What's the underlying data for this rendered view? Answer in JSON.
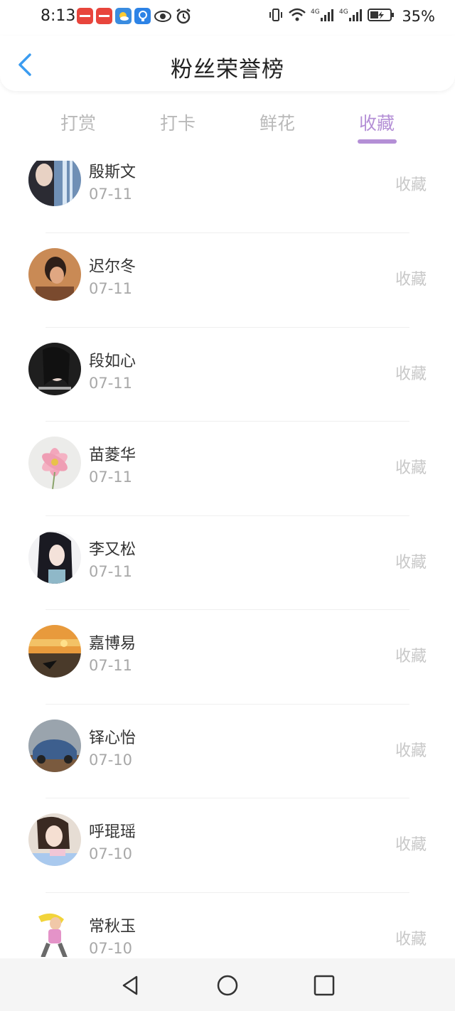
{
  "status_bar": {
    "time": "8:13",
    "battery": "35%",
    "icons": [
      "huawei-app-icon",
      "huawei-app-icon",
      "weather-icon",
      "bulb-icon",
      "eye-icon",
      "alarm-icon",
      "vibrate-icon",
      "wifi-icon",
      "signal-4g-icon",
      "signal-4g-icon",
      "battery-icon"
    ]
  },
  "header": {
    "title": "粉丝荣誉榜",
    "back_icon": "chevron-left-icon"
  },
  "tabs": [
    {
      "label": "打赏",
      "active": false
    },
    {
      "label": "打卡",
      "active": false
    },
    {
      "label": "鲜花",
      "active": false
    },
    {
      "label": "收藏",
      "active": true
    }
  ],
  "accent_color": "#b48fd6",
  "rows": [
    {
      "name": "殷斯文",
      "date": "07-11",
      "action": "收藏"
    },
    {
      "name": "迟尔冬",
      "date": "07-11",
      "action": "收藏"
    },
    {
      "name": "段如心",
      "date": "07-11",
      "action": "收藏"
    },
    {
      "name": "苗菱华",
      "date": "07-11",
      "action": "收藏"
    },
    {
      "name": "李又松",
      "date": "07-11",
      "action": "收藏"
    },
    {
      "name": "嘉博易",
      "date": "07-11",
      "action": "收藏"
    },
    {
      "name": "铎心怡",
      "date": "07-10",
      "action": "收藏"
    },
    {
      "name": "呼琨瑶",
      "date": "07-10",
      "action": "收藏"
    },
    {
      "name": "常秋玉",
      "date": "07-10",
      "action": "收藏"
    }
  ],
  "nav_bar": [
    "back-triangle-icon",
    "home-circle-icon",
    "recents-square-icon"
  ]
}
